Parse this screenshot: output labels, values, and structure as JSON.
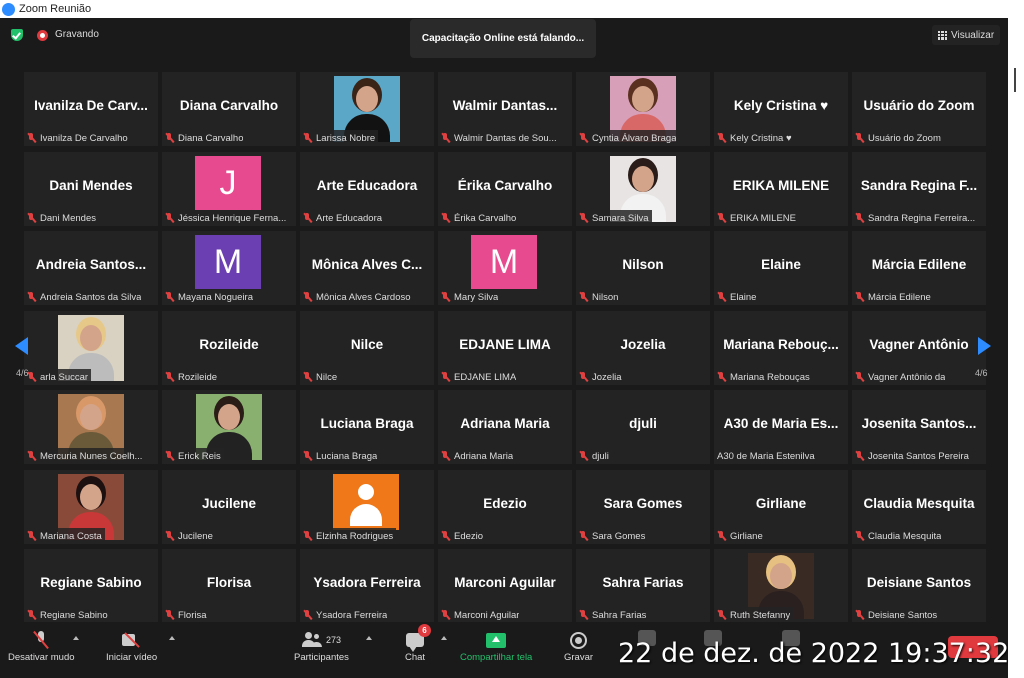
{
  "window": {
    "title": "Zoom Reunião"
  },
  "topbar": {
    "recording_label": "Gravando",
    "speaking_text": "Capacitação Online está falando...",
    "view_label": "Visualizar"
  },
  "pagination": {
    "left": "4/6",
    "right": "4/6"
  },
  "colors": {
    "accent": "#2d8cff",
    "pink": "#e84a8f",
    "purple": "#6b3fb2",
    "orange": "#f07818",
    "mute_red": "#e04040"
  },
  "tiles": [
    [
      {
        "big": "Ivanilza De Carv...",
        "label": "Ivanilza De Carvalho"
      },
      {
        "big": "Diana Carvalho",
        "label": "Diana Carvalho"
      },
      {
        "photo": [
          "#5aa7c7",
          "#3a2418",
          "#121212"
        ],
        "label": "Larissa Nobre"
      },
      {
        "big": "Walmir  Dantas...",
        "label": "Walmir Dantas de Sou..."
      },
      {
        "photo": [
          "#d8a0b8",
          "#5a3020",
          "#d86868"
        ],
        "label": "Cyntia Álvaro Braga"
      },
      {
        "big": "Kely Cristina ♥",
        "label": "Kely Cristina ♥"
      },
      {
        "big": "Usuário do Zoom",
        "label": "Usuário do Zoom"
      }
    ],
    [
      {
        "big": "Dani Mendes",
        "label": "Dani Mendes"
      },
      {
        "letter": "J",
        "color": "#e84a8f",
        "label": "Jéssica Henrique Ferna..."
      },
      {
        "big": "Arte Educadora",
        "label": "Arte Educadora"
      },
      {
        "big": "Érika Carvalho",
        "label": "Érika Carvalho"
      },
      {
        "photo": [
          "#e8e4e4",
          "#2a1c18",
          "#f2f2f2"
        ],
        "label": "Samara Silva"
      },
      {
        "big": "ERIKA MILENE",
        "label": "ERIKA MILENE"
      },
      {
        "big": "Sandra Regina F...",
        "label": "Sandra Regina Ferreira..."
      }
    ],
    [
      {
        "big": "Andreia  Santos...",
        "label": "Andreia Santos da Silva"
      },
      {
        "letter": "M",
        "color": "#6b3fb2",
        "label": "Mayana Nogueira"
      },
      {
        "big": "Mônica  Alves  C...",
        "label": "Mônica Alves Cardoso"
      },
      {
        "letter": "M",
        "color": "#e84a8f",
        "label": "Mary Silva"
      },
      {
        "big": "Nilson",
        "label": "Nilson"
      },
      {
        "big": "Elaine",
        "label": "Elaine"
      },
      {
        "big": "Márcia Edilene",
        "label": "Márcia Edilene"
      }
    ],
    [
      {
        "photo": [
          "#d9d2c2",
          "#e6c888",
          "#bcbcbc"
        ],
        "label": "arla Succar"
      },
      {
        "big": "Rozileide",
        "label": "Rozileide"
      },
      {
        "big": "Nilce",
        "label": "Nilce"
      },
      {
        "big": "EDJANE LIMA",
        "label": "EDJANE LIMA"
      },
      {
        "big": "Jozelia",
        "label": "Jozelia"
      },
      {
        "big": "Mariana  Rebouç...",
        "label": "Mariana Rebouças"
      },
      {
        "big": "Vagner  Antônio",
        "label": "Vagner Antônio da"
      }
    ],
    [
      {
        "photo": [
          "#a87850",
          "#d89868",
          "#6a5a3a"
        ],
        "label": "Mercuria Nunes Coelh..."
      },
      {
        "photo": [
          "#8ab070",
          "#2a1c16",
          "#222222"
        ],
        "label": "Erick Reis"
      },
      {
        "big": "Luciana Braga",
        "label": "Luciana Braga"
      },
      {
        "big": "Adriana Maria",
        "label": "Adriana Maria"
      },
      {
        "big": "djuli",
        "label": "djuli"
      },
      {
        "big": "A30 de Maria Es...",
        "label": "A30 de Maria Estenilva",
        "nomic": true
      },
      {
        "big": "Josenita  Santos...",
        "label": "Josenita Santos Pereira"
      }
    ],
    [
      {
        "photo": [
          "#8a4a3a",
          "#1c1010",
          "#c83838"
        ],
        "label": "Mariana Costa"
      },
      {
        "big": "Jucilene",
        "label": "Jucilene"
      },
      {
        "default": true,
        "label": "Elzinha Rodrigues"
      },
      {
        "big": "Edezio",
        "label": "Edezio"
      },
      {
        "big": "Sara Gomes",
        "label": "Sara Gomes"
      },
      {
        "big": "Girliane",
        "label": "Girliane"
      },
      {
        "big": "Claudia Mesquita",
        "label": "Claudia Mesquita"
      }
    ],
    [
      {
        "big": "Regiane Sabino",
        "label": "Regiane Sabino"
      },
      {
        "big": "Florisa",
        "label": "Florisa"
      },
      {
        "big": "Ysadora Ferreira",
        "label": "Ysadora Ferreira"
      },
      {
        "big": "Marconi Aguilar",
        "label": "Marconi Aguilar"
      },
      {
        "big": "Sahra Farias",
        "label": "Sahra Farias"
      },
      {
        "photo": [
          "#3a2a24",
          "#e6c080",
          "#2a2020"
        ],
        "label": "Ruth Stefanny"
      },
      {
        "big": "Deisiane Santos",
        "label": "Deisiane Santos"
      }
    ]
  ],
  "toolbar": {
    "mute_label": "Desativar mudo",
    "video_label": "Iniciar vídeo",
    "participants_label": "Participantes",
    "participants_count": "273",
    "chat_label": "Chat",
    "chat_badge": "6",
    "share_label": "Compartilhar tela",
    "record_label": "Gravar"
  },
  "timestamp": "22 de dez. de 2022 19:37:32"
}
